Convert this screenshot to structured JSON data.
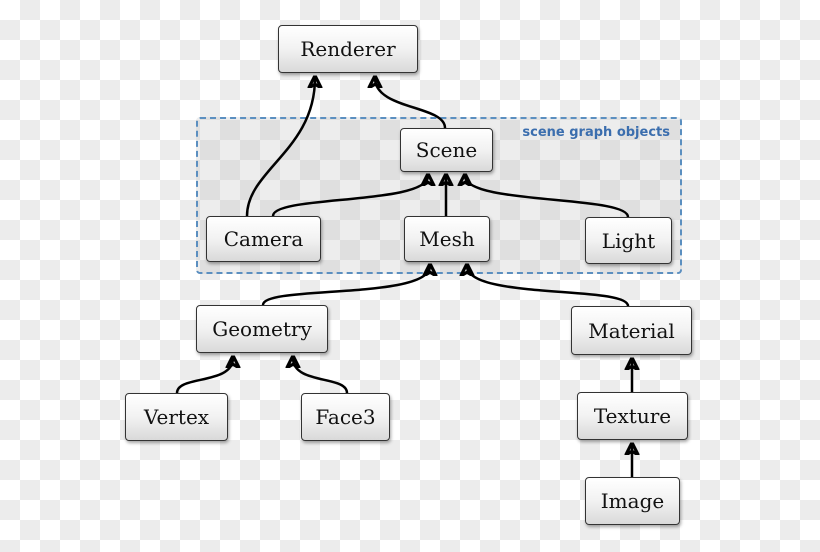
{
  "diagram": {
    "group_label": "scene graph objects",
    "nodes": {
      "renderer": "Renderer",
      "scene": "Scene",
      "camera": "Camera",
      "mesh": "Mesh",
      "light": "Light",
      "geometry": "Geometry",
      "material": "Material",
      "vertex": "Vertex",
      "face3": "Face3",
      "texture": "Texture",
      "image": "Image"
    },
    "edges": [
      {
        "from": "Camera",
        "to": "Renderer"
      },
      {
        "from": "Scene",
        "to": "Renderer"
      },
      {
        "from": "Camera",
        "to": "Scene"
      },
      {
        "from": "Mesh",
        "to": "Scene"
      },
      {
        "from": "Light",
        "to": "Scene"
      },
      {
        "from": "Geometry",
        "to": "Mesh"
      },
      {
        "from": "Material",
        "to": "Mesh"
      },
      {
        "from": "Vertex",
        "to": "Geometry"
      },
      {
        "from": "Face3",
        "to": "Geometry"
      },
      {
        "from": "Texture",
        "to": "Material"
      },
      {
        "from": "Image",
        "to": "Texture"
      }
    ]
  }
}
